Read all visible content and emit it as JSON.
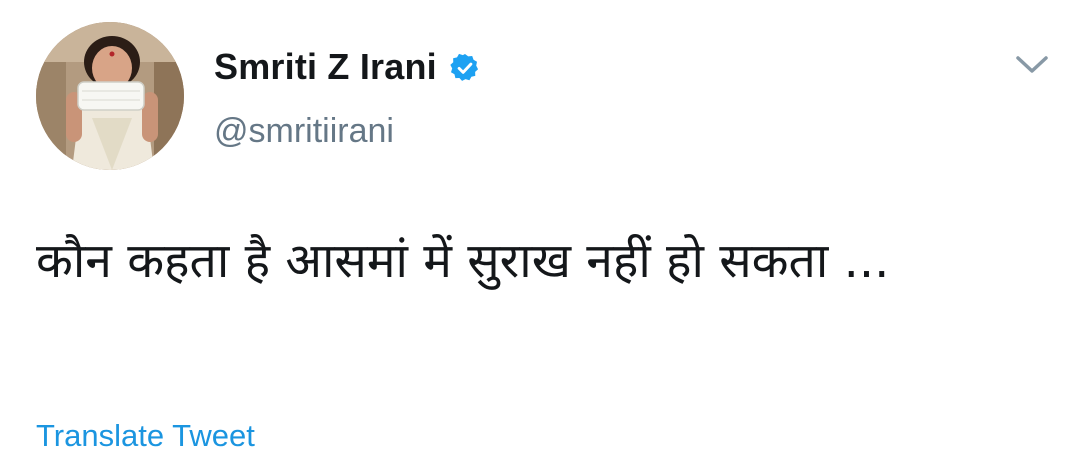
{
  "tweet": {
    "display_name": "Smriti Z Irani",
    "handle": "@smritiirani",
    "verified_icon": "verified-badge-icon",
    "menu_icon": "chevron-down-icon",
    "text": "कौन कहता है आसमां में सुराख नहीं हो सकता ...",
    "translate_label": "Translate Tweet"
  },
  "colors": {
    "name": "#14171a",
    "handle": "#657786",
    "link": "#1b95e0",
    "verified": "#1da1f2",
    "chevron": "#8899a6"
  }
}
